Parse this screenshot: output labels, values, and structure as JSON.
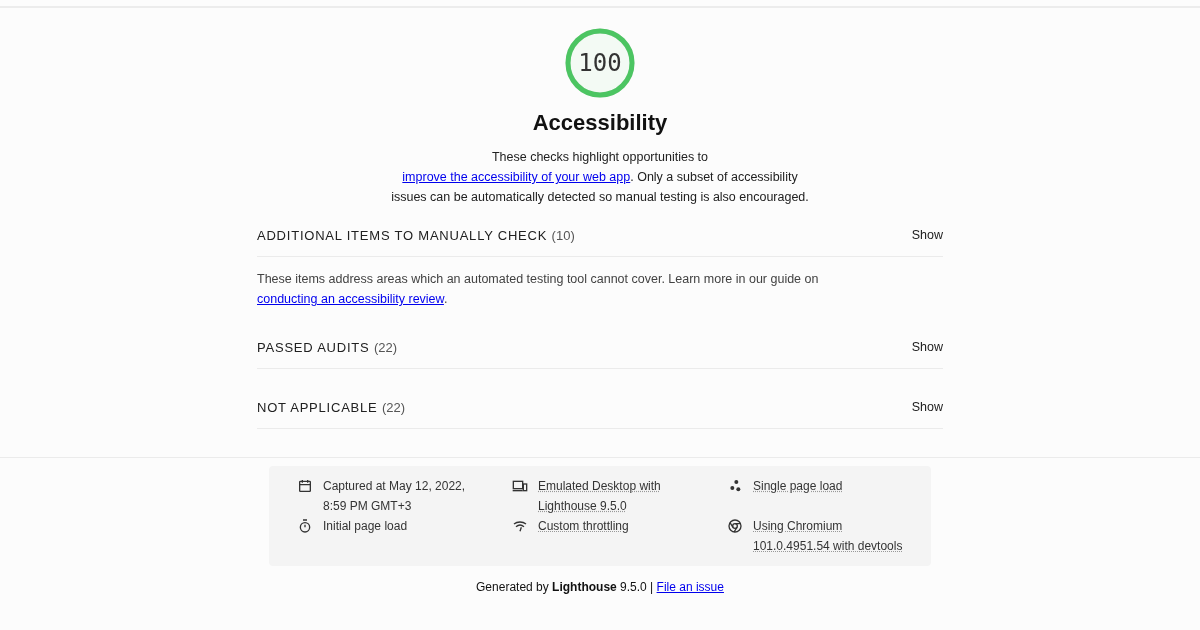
{
  "gauge": {
    "score": "100",
    "level": 1
  },
  "title": "Accessibility",
  "intro": {
    "before": "These checks highlight opportunities to ",
    "link": "improve the accessibility of your web app",
    "after": ". Only a subset of accessibility issues can be automatically detected so manual testing is also encouraged."
  },
  "groups": [
    {
      "title": "ADDITIONAL ITEMS TO MANUALLY CHECK",
      "count": "(10)",
      "toggle": "Show",
      "description": {
        "before": "These items address areas which an automated testing tool cannot cover. Learn more in our guide on ",
        "link": "conducting an accessibility review",
        "after": "."
      }
    },
    {
      "title": "PASSED AUDITS",
      "count": "(22)",
      "toggle": "Show"
    },
    {
      "title": "NOT APPLICABLE",
      "count": "(22)",
      "toggle": "Show"
    }
  ],
  "environment": [
    {
      "kind": "calendar",
      "text": "Captured at May 12, 2022, 8:59 PM GMT+3",
      "dotted": false
    },
    {
      "kind": "devices",
      "text": "Emulated Desktop with Lighthouse 9.5.0",
      "dotted": true
    },
    {
      "kind": "dots",
      "text": "Single page load",
      "dotted": true
    },
    {
      "kind": "timer",
      "text": "Initial page load",
      "dotted": false
    },
    {
      "kind": "wifi",
      "text": "Custom throttling",
      "dotted": true
    },
    {
      "kind": "chrome",
      "text": "Using Chromium 101.0.4951.54 with devtools",
      "dotted": true
    }
  ],
  "footer": {
    "text": "Generated by **Lighthouse** 9.5.0 | ",
    "link": "File an issue"
  }
}
